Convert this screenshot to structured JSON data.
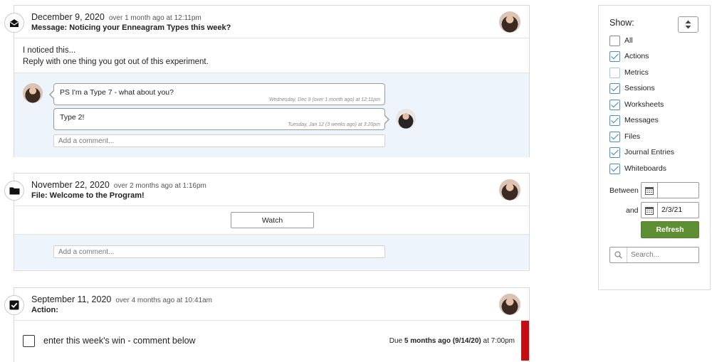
{
  "feed": {
    "message_card": {
      "date": "December 9, 2020",
      "ago": "over 1 month ago at 12:11pm",
      "title": "Message: Noticing your Enneagram Types this week?",
      "icon": "envelope-open-icon",
      "body_line1": "I noticed this...",
      "body_line2": "Reply with one thing you got out of this experiment.",
      "comments": [
        {
          "text": "PS I'm a Type 7 - what about you?",
          "meta": "Wednesday, Dec 9 (over 1 month ago) at 12:11pm"
        },
        {
          "text": "Type 2!",
          "meta": "Tuesday, Jan 12 (3 weeks ago) at 3:20pm"
        }
      ],
      "comment_placeholder": "Add a comment..."
    },
    "file_card": {
      "date": "November 22, 2020",
      "ago": "over 2 months ago at 1:16pm",
      "title": "File: Welcome to the Program!",
      "icon": "folder-icon",
      "watch_label": "Watch",
      "comment_placeholder": "Add a comment..."
    },
    "action_card": {
      "date": "September 11, 2020",
      "ago": "over 4 months ago at 10:41am",
      "title": "Action:",
      "icon": "checkbox-checked-icon",
      "task": "enter this week's win - comment below",
      "due_prefix": "Due",
      "due_bold": "5 months ago (9/14/20)",
      "due_time": "at 7:00pm",
      "overdue_color": "#c40d12"
    }
  },
  "filter": {
    "show_label": "Show:",
    "items": [
      {
        "label": "All",
        "checked": false
      },
      {
        "label": "Actions",
        "checked": true
      },
      {
        "label": "Metrics",
        "checked": false
      },
      {
        "label": "Sessions",
        "checked": true
      },
      {
        "label": "Worksheets",
        "checked": true
      },
      {
        "label": "Messages",
        "checked": true
      },
      {
        "label": "Files",
        "checked": true
      },
      {
        "label": "Journal Entries",
        "checked": true
      },
      {
        "label": "Whiteboards",
        "checked": true
      }
    ],
    "between_label": "Between",
    "and_label": "and",
    "start_date": "",
    "end_date": "2/3/21",
    "refresh_label": "Refresh",
    "search_placeholder": "Search...",
    "accent_color": "#5f8f33"
  }
}
